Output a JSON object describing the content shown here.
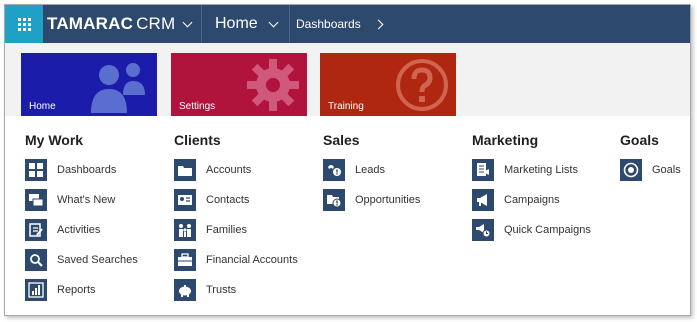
{
  "header": {
    "brand_main": "TAMARAC",
    "brand_sub": "CRM",
    "nav_current": "Home",
    "breadcrumb": "Dashboards"
  },
  "tiles": [
    {
      "label": "Home",
      "color": "#1c1caa"
    },
    {
      "label": "Settings",
      "color": "#b0143c"
    },
    {
      "label": "Training",
      "color": "#b02711"
    }
  ],
  "columns": {
    "mywork": {
      "title": "My Work",
      "items": [
        "Dashboards",
        "What's New",
        "Activities",
        "Saved Searches",
        "Reports"
      ]
    },
    "clients": {
      "title": "Clients",
      "items": [
        "Accounts",
        "Contacts",
        "Families",
        "Financial Accounts",
        "Trusts"
      ]
    },
    "sales": {
      "title": "Sales",
      "items": [
        "Leads",
        "Opportunities"
      ]
    },
    "marketing": {
      "title": "Marketing",
      "items": [
        "Marketing Lists",
        "Campaigns",
        "Quick Campaigns"
      ]
    },
    "goals": {
      "title": "Goals",
      "items": [
        "Goals"
      ]
    }
  },
  "icons": {
    "mywork": [
      "dashboard-icon",
      "whats-new-icon",
      "activities-icon",
      "saved-searches-icon",
      "reports-icon"
    ],
    "clients": [
      "accounts-icon",
      "contacts-icon",
      "families-icon",
      "financial-accounts-icon",
      "trusts-icon"
    ],
    "sales": [
      "leads-icon",
      "opportunities-icon"
    ],
    "marketing": [
      "marketing-lists-icon",
      "campaigns-icon",
      "quick-campaigns-icon"
    ],
    "goals": [
      "goals-icon"
    ]
  },
  "colors": {
    "topbar": "#2d4a6e",
    "waffle": "#1fa0c5",
    "icon_bg": "#2d4a6e"
  }
}
